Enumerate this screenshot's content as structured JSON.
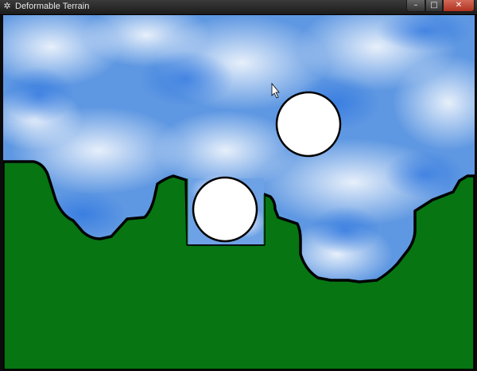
{
  "window": {
    "title": "Deformable Terrain",
    "buttons": {
      "minimize": "–",
      "maximize": "□",
      "close": "✕"
    }
  },
  "scene": {
    "terrain_color": "#067512",
    "sky_color": "#5f98e2",
    "balls": 2,
    "cursor": "arrow-cursor"
  }
}
